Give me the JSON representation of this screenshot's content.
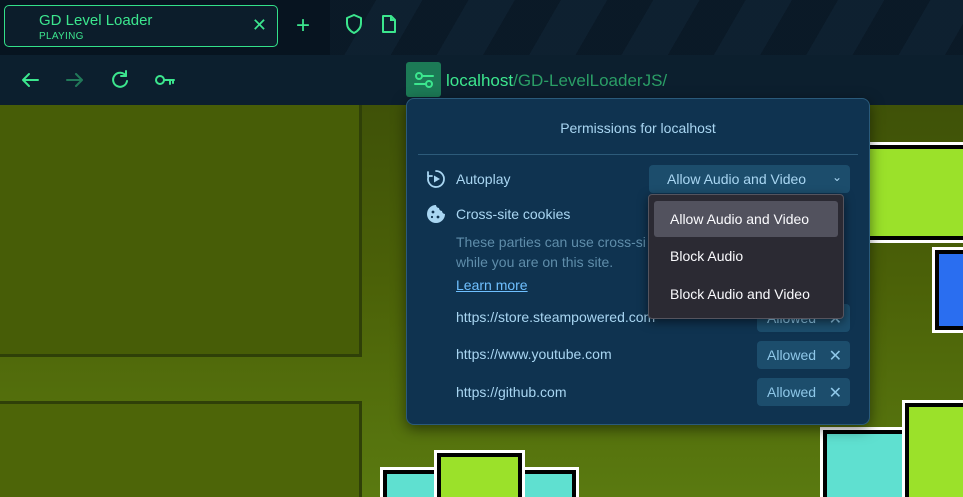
{
  "tab": {
    "title": "GD Level Loader",
    "status": "PLAYING"
  },
  "url": {
    "host": "localhost",
    "path": "/GD-LevelLoaderJS/"
  },
  "panel": {
    "title": "Permissions for localhost",
    "autoplay_label": "Autoplay",
    "autoplay_value": "Allow Audio and Video",
    "cookies_label": "Cross-site cookies",
    "cookies_desc": "These parties can use cross-si\nwhile you are on this site.",
    "learn_more": "Learn more",
    "sites": [
      {
        "url": "https://store.steampowered.com",
        "status": "Allowed"
      },
      {
        "url": "https://www.youtube.com",
        "status": "Allowed"
      },
      {
        "url": "https://github.com",
        "status": "Allowed"
      }
    ]
  },
  "dropdown": {
    "options": [
      "Allow Audio and Video",
      "Block Audio",
      "Block Audio and Video"
    ],
    "selected": "Allow Audio and Video"
  },
  "colors": {
    "accent": "#3ce68e",
    "panel_bg": "#0f3350",
    "dropdown_bg": "#2b2a33"
  }
}
